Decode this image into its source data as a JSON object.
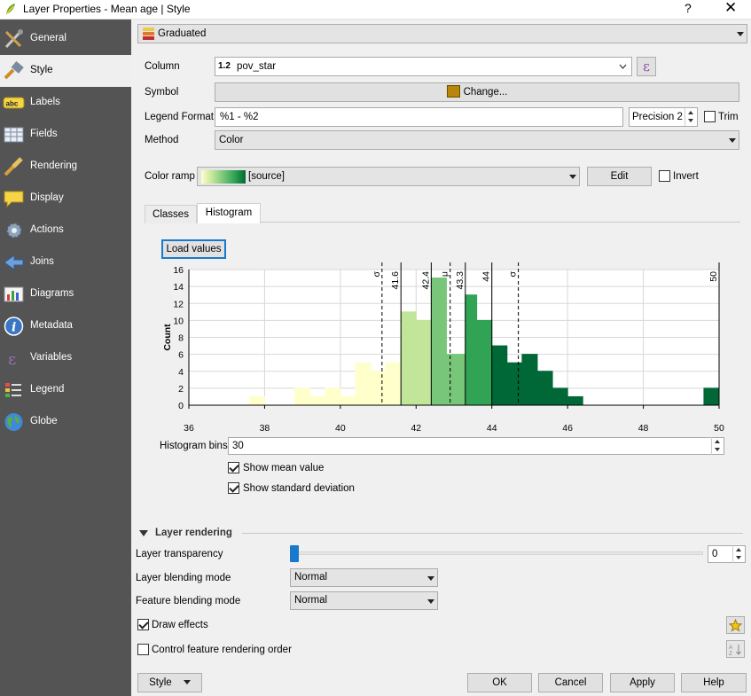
{
  "window": {
    "title": "Layer Properties - Mean age | Style",
    "help": "?",
    "close": "✕"
  },
  "sidebar": {
    "items": [
      {
        "label": "General",
        "icon": "general-tools-icon"
      },
      {
        "label": "Style",
        "icon": "style-brush-icon",
        "selected": true
      },
      {
        "label": "Labels",
        "icon": "labels-abc-icon"
      },
      {
        "label": "Fields",
        "icon": "fields-table-icon"
      },
      {
        "label": "Rendering",
        "icon": "rendering-brush-icon"
      },
      {
        "label": "Display",
        "icon": "display-speech-icon"
      },
      {
        "label": "Actions",
        "icon": "actions-gear-icon"
      },
      {
        "label": "Joins",
        "icon": "joins-arrow-icon"
      },
      {
        "label": "Diagrams",
        "icon": "diagrams-chart-icon"
      },
      {
        "label": "Metadata",
        "icon": "metadata-info-icon"
      },
      {
        "label": "Variables",
        "icon": "variables-epsilon-icon"
      },
      {
        "label": "Legend",
        "icon": "legend-list-icon"
      },
      {
        "label": "Globe",
        "icon": "globe-icon"
      }
    ]
  },
  "renderer": {
    "value": "Graduated"
  },
  "form": {
    "column_label": "Column",
    "column_value": "pov_star",
    "column_prefix": "1.2",
    "expression_glyph": "ε",
    "symbol_label": "Symbol",
    "symbol_button": "Change...",
    "legend_format_label": "Legend Format",
    "legend_format_value": "%1 - %2",
    "precision_value": "Precision 2",
    "trim_label": "Trim",
    "method_label": "Method",
    "method_value": "Color",
    "color_ramp_label": "Color ramp",
    "color_ramp_value": "[source]",
    "edit_button": "Edit",
    "invert_label": "Invert"
  },
  "colors": {
    "accent": "#1979ca",
    "symbol_fill": "#b8860b",
    "ramp_start": "#ffffcc",
    "ramp_end": "#006837"
  },
  "tabs": [
    {
      "label": "Classes"
    },
    {
      "label": "Histogram",
      "active": true
    }
  ],
  "histogram": {
    "load_values_button": "Load values",
    "bins_label": "Histogram bins",
    "bins_value": "30",
    "show_mean_label": "Show mean value",
    "show_mean_checked": true,
    "show_std_label": "Show standard deviation",
    "show_std_checked": true
  },
  "chart_data": {
    "type": "bar",
    "ylabel": "Count",
    "xlim": [
      36,
      50
    ],
    "ylim": [
      0,
      16
    ],
    "x_ticks": [
      36,
      38,
      40,
      42,
      44,
      46,
      48,
      50
    ],
    "y_ticks": [
      0,
      2,
      4,
      6,
      8,
      10,
      12,
      14,
      16
    ],
    "grid": true,
    "bins": [
      {
        "start": 37.6,
        "end": 38.0,
        "count": 1,
        "color": "#ffffcc"
      },
      {
        "start": 38.8,
        "end": 39.2,
        "count": 2,
        "color": "#ffffcc"
      },
      {
        "start": 39.2,
        "end": 39.6,
        "count": 1,
        "color": "#ffffcc"
      },
      {
        "start": 39.6,
        "end": 40.0,
        "count": 2,
        "color": "#ffffcc"
      },
      {
        "start": 40.0,
        "end": 40.4,
        "count": 1,
        "color": "#ffffcc"
      },
      {
        "start": 40.4,
        "end": 40.8,
        "count": 5,
        "color": "#ffffcc"
      },
      {
        "start": 40.8,
        "end": 41.2,
        "count": 4,
        "color": "#ffffcc"
      },
      {
        "start": 41.2,
        "end": 41.6,
        "count": 5,
        "color": "#ffffcc"
      },
      {
        "start": 41.6,
        "end": 42.0,
        "count": 11,
        "color": "#c2e699"
      },
      {
        "start": 42.0,
        "end": 42.4,
        "count": 10,
        "color": "#c2e699"
      },
      {
        "start": 42.4,
        "end": 42.8,
        "count": 15,
        "color": "#78c679"
      },
      {
        "start": 42.8,
        "end": 43.3,
        "count": 6,
        "color": "#78c679"
      },
      {
        "start": 43.3,
        "end": 43.6,
        "count": 13,
        "color": "#31a354"
      },
      {
        "start": 43.6,
        "end": 44.0,
        "count": 10,
        "color": "#31a354"
      },
      {
        "start": 44.0,
        "end": 44.4,
        "count": 7,
        "color": "#006837"
      },
      {
        "start": 44.4,
        "end": 44.8,
        "count": 5,
        "color": "#006837"
      },
      {
        "start": 44.8,
        "end": 45.2,
        "count": 6,
        "color": "#006837"
      },
      {
        "start": 45.2,
        "end": 45.6,
        "count": 4,
        "color": "#006837"
      },
      {
        "start": 45.6,
        "end": 46.0,
        "count": 2,
        "color": "#006837"
      },
      {
        "start": 46.0,
        "end": 46.4,
        "count": 1,
        "color": "#006837"
      },
      {
        "start": 49.6,
        "end": 50.0,
        "count": 2,
        "color": "#006837"
      }
    ],
    "break_lines": [
      {
        "x": 41.6,
        "label": "41.6"
      },
      {
        "x": 42.4,
        "label": "42.4"
      },
      {
        "x": 43.3,
        "label": "43.3"
      },
      {
        "x": 44.0,
        "label": "44"
      },
      {
        "x": 50.0,
        "label": "50"
      }
    ],
    "mean_line": {
      "x": 42.9,
      "label": "μ"
    },
    "std_lines": [
      {
        "x": 41.1,
        "label": "σ"
      },
      {
        "x": 44.7,
        "label": "σ"
      }
    ]
  },
  "layer_rendering": {
    "header": "Layer rendering",
    "transparency_label": "Layer transparency",
    "transparency_value": "0",
    "transparency_level": 0,
    "blending_label": "Layer blending mode",
    "blending_value": "Normal",
    "feature_blending_label": "Feature blending mode",
    "feature_blending_value": "Normal",
    "draw_effects_label": "Draw effects",
    "draw_effects_checked": true,
    "order_label": "Control feature rendering order",
    "order_checked": false
  },
  "footer": {
    "style_button": "Style",
    "ok_button": "OK",
    "cancel_button": "Cancel",
    "apply_button": "Apply",
    "help_button": "Help"
  }
}
